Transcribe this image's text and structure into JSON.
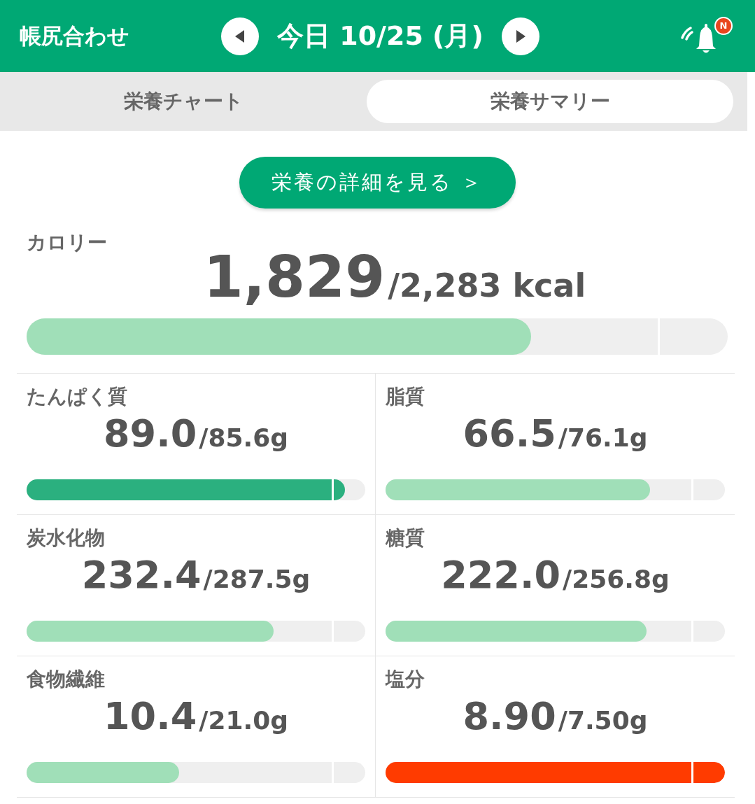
{
  "header": {
    "title": "帳尻合わせ",
    "date": "今日 10/25 (月)",
    "notification_badge": "N"
  },
  "tabs": [
    {
      "label": "栄養チャート",
      "selected": false
    },
    {
      "label": "栄養サマリー",
      "selected": true
    }
  ],
  "detail_button": "栄養の詳細を見る ＞",
  "calorie": {
    "label": "カロリー",
    "value": "1,829",
    "target": "/2,283 kcal",
    "level": 0.72,
    "color": "#a0dfb8"
  },
  "nutrients": [
    {
      "label": "たんぱく質",
      "value": "89.0",
      "target": "/85.6g",
      "level": 0.94,
      "color": "#2bb07f"
    },
    {
      "label": "脂質",
      "value": "66.5",
      "target": "/76.1g",
      "level": 0.78,
      "color": "#a0dfb8"
    },
    {
      "label": "炭水化物",
      "value": "232.4",
      "target": "/287.5g",
      "level": 0.73,
      "color": "#a0dfb8"
    },
    {
      "label": "糖質",
      "value": "222.0",
      "target": "/256.8g",
      "level": 0.77,
      "color": "#a0dfb8"
    },
    {
      "label": "食物繊維",
      "value": "10.4",
      "target": "/21.0g",
      "level": 0.45,
      "color": "#a0dfb8"
    },
    {
      "label": "塩分",
      "value": "8.90",
      "target": "/7.50g",
      "level": 1.0,
      "color": "#ff3b00"
    }
  ]
}
